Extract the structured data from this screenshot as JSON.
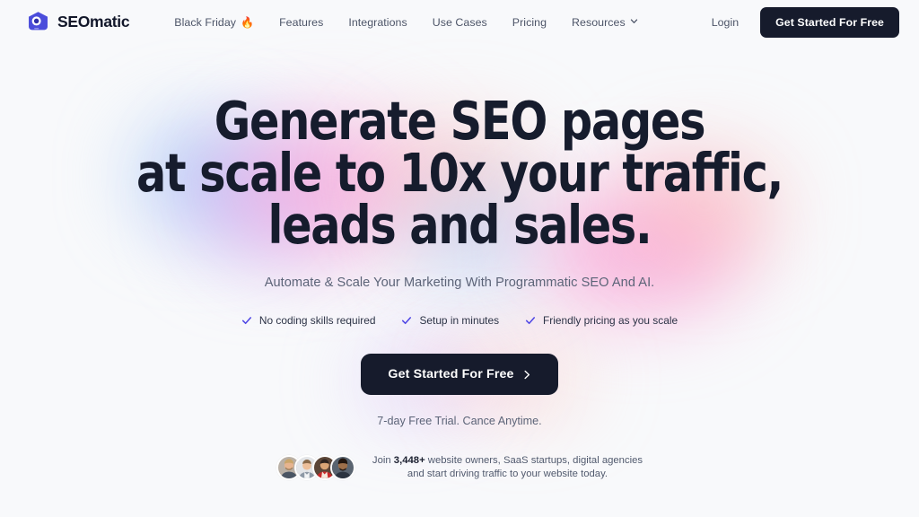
{
  "theme": {
    "background": "#f8f9fb",
    "text_dark": "#161c2d",
    "text_muted": "#5c6478",
    "accent_dark": "#161b2c",
    "accent_blue": "#4f46e5",
    "logo_blue": "#4b4ddb"
  },
  "header": {
    "brand": {
      "name": "SEOmatic",
      "logo_icon": "seomatic-hexagon-eye-logo"
    },
    "nav": [
      {
        "label": "Black Friday",
        "emoji": "🔥",
        "has_emoji": true,
        "has_chevron": false
      },
      {
        "label": "Features",
        "has_emoji": false,
        "has_chevron": false
      },
      {
        "label": "Integrations",
        "has_emoji": false,
        "has_chevron": false
      },
      {
        "label": "Use Cases",
        "has_emoji": false,
        "has_chevron": false
      },
      {
        "label": "Pricing",
        "has_emoji": false,
        "has_chevron": false
      },
      {
        "label": "Resources",
        "has_emoji": false,
        "has_chevron": true
      }
    ],
    "login_label": "Login",
    "cta_label": "Get Started For Free"
  },
  "hero": {
    "headline_lines": [
      "Generate SEO pages",
      "at scale to 10x your traffic,",
      "leads and sales."
    ],
    "subheadline": "Automate & Scale Your Marketing With Programmatic SEO And AI.",
    "features": [
      "No coding skills required",
      "Setup in minutes",
      "Friendly pricing as you scale"
    ],
    "cta_label": "Get Started For Free",
    "cta_arrow": "›",
    "trial_note": "7-day Free Trial. Cance Anytime.",
    "social_proof": {
      "avatar_count": 4,
      "avatars": [
        {
          "name": "avatar-person-1"
        },
        {
          "name": "avatar-person-2"
        },
        {
          "name": "avatar-person-3"
        },
        {
          "name": "avatar-person-4"
        }
      ],
      "line1_prefix": "Join ",
      "count": "3,448+",
      "line1_suffix": " website owners, SaaS startups, digital agencies",
      "line2": "and start driving traffic to your website today."
    }
  }
}
